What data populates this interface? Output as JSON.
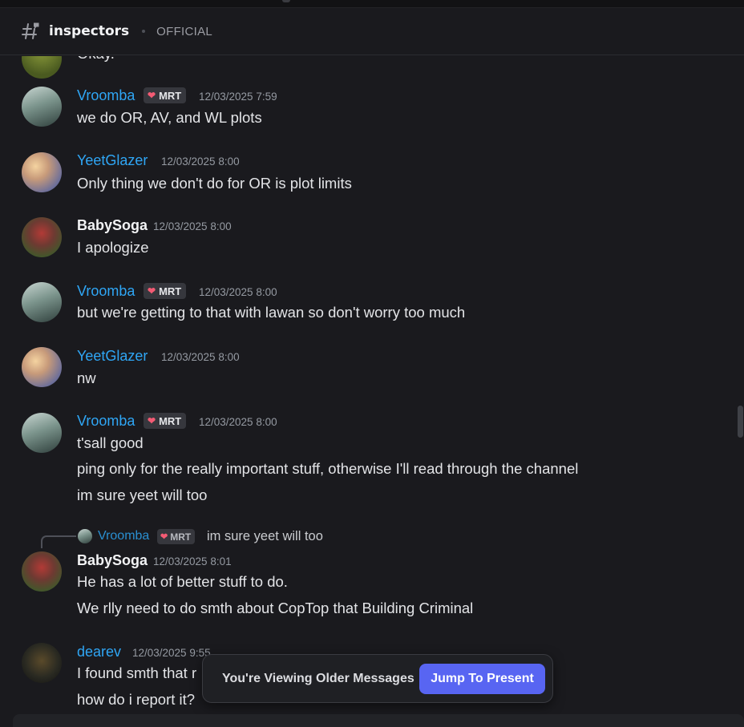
{
  "header": {
    "channel_name": "inspectors",
    "topic": "OFFICIAL"
  },
  "partial_top_message": "Okay.",
  "messages": [
    {
      "username": "Vroomba",
      "tag": "MRT",
      "timestamp": "12/03/2025 7:59",
      "lines": [
        "we do OR, AV, and WL plots"
      ]
    },
    {
      "username": "YeetGlazer",
      "timestamp": "12/03/2025 8:00",
      "lines": [
        "Only thing we don't do for OR is plot limits"
      ]
    },
    {
      "username": "BabySoga",
      "timestamp": "12/03/2025 8:00",
      "lines": [
        "I apologize"
      ]
    },
    {
      "username": "Vroomba",
      "tag": "MRT",
      "timestamp": "12/03/2025 8:00",
      "lines": [
        "but we're getting to that with lawan so don't worry too much"
      ]
    },
    {
      "username": "YeetGlazer",
      "timestamp": "12/03/2025 8:00",
      "lines": [
        "nw"
      ]
    },
    {
      "username": "Vroomba",
      "tag": "MRT",
      "timestamp": "12/03/2025 8:00",
      "lines": [
        "t'sall good",
        "ping only for the really important stuff, otherwise I'll read through the channel",
        "im sure yeet will too"
      ]
    },
    {
      "reply_to": {
        "username": "Vroomba",
        "tag": "MRT",
        "text": "im sure yeet will too"
      },
      "username": "BabySoga",
      "timestamp": "12/03/2025 8:01",
      "lines": [
        "He has a lot of better stuff to do.",
        "We rlly need to do smth about CopTop that Building Criminal"
      ]
    },
    {
      "username": "dearev",
      "timestamp": "12/03/2025 9:55",
      "lines": [
        "I found smth that r",
        "how do i report it?"
      ]
    }
  ],
  "older_bar": {
    "text": "You're Viewing Older Messages",
    "button": "Jump To Present"
  },
  "colors": {
    "background": "#1a1a1e",
    "username_blue": "#2fa6f5",
    "accent": "#5865f2",
    "tag_heart": "#f45b74"
  },
  "icons": {
    "header_channel": "threads-hash-icon",
    "tag_badge": "heart-icon"
  }
}
